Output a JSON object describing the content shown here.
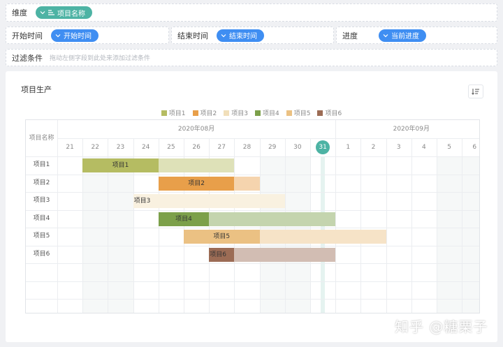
{
  "filters": {
    "dimension": {
      "label": "维度",
      "pill": "项目名称"
    },
    "start_time": {
      "label": "开始时间",
      "pill": "开始时间"
    },
    "end_time": {
      "label": "结束时间",
      "pill": "结束时间"
    },
    "progress": {
      "label": "进度",
      "pill": "当前进度"
    },
    "filter_condition": {
      "label": "过滤条件",
      "hint": "拖动左侧字段到此处来添加过滤条件"
    }
  },
  "chart": {
    "title": "项目生产",
    "sort_icon": "sort-icon",
    "row_header": "项目名称",
    "months": [
      "2020年08月",
      "2020年09月"
    ],
    "days": [
      "21",
      "22",
      "23",
      "24",
      "25",
      "26",
      "27",
      "28",
      "29",
      "30",
      "31",
      "1",
      "2",
      "3",
      "4",
      "5",
      "6"
    ],
    "today": "31",
    "colors": {
      "teal": "#4db3a4",
      "blue": "#3f8ef2"
    }
  },
  "chart_data": {
    "type": "gantt",
    "title": "项目生产",
    "legend": [
      "项目1",
      "项目2",
      "项目3",
      "项目4",
      "项目5",
      "项目6"
    ],
    "colors": [
      "#b5bc62",
      "#e89f4a",
      "#f1dfba",
      "#7ca04a",
      "#ebc183",
      "#9c6c55"
    ],
    "tasks": [
      {
        "name": "项目1",
        "start": "2020-08-22",
        "end": "2020-08-28",
        "progress_end": "2020-08-25"
      },
      {
        "name": "项目2",
        "start": "2020-08-25",
        "end": "2020-08-29",
        "progress_end": "2020-08-28"
      },
      {
        "name": "项目3",
        "start": "2020-08-24",
        "end": "2020-08-30",
        "progress_end": "2020-08-24"
      },
      {
        "name": "项目4",
        "start": "2020-08-25",
        "end": "2020-09-01",
        "progress_end": "2020-08-27"
      },
      {
        "name": "项目5",
        "start": "2020-08-26",
        "end": "2020-09-03",
        "progress_end": "2020-08-29"
      },
      {
        "name": "项目6",
        "start": "2020-08-27",
        "end": "2020-09-01",
        "progress_end": "2020-08-28"
      }
    ]
  },
  "watermark": "知乎 @糖栗子"
}
